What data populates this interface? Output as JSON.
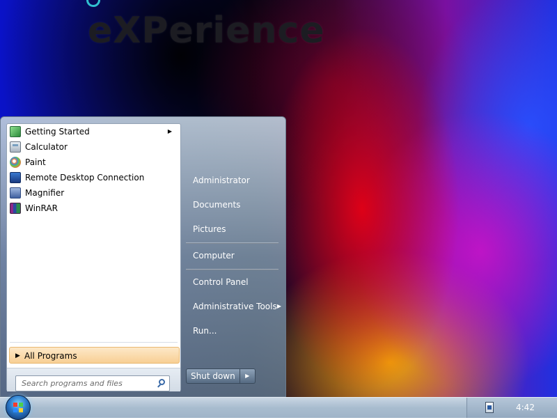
{
  "wallpaper": {
    "logo_text": "eXPerience"
  },
  "start_menu": {
    "programs": [
      {
        "label": "Getting Started",
        "icon": "getting-started-icon",
        "has_submenu": true
      },
      {
        "label": "Calculator",
        "icon": "calculator-icon",
        "has_submenu": false
      },
      {
        "label": "Paint",
        "icon": "paint-icon",
        "has_submenu": false
      },
      {
        "label": "Remote Desktop Connection",
        "icon": "remote-desktop-icon",
        "has_submenu": false
      },
      {
        "label": "Magnifier",
        "icon": "magnifier-icon",
        "has_submenu": false
      },
      {
        "label": "WinRAR",
        "icon": "winrar-icon",
        "has_submenu": false
      }
    ],
    "all_programs_label": "All Programs",
    "search": {
      "placeholder": "Search programs and files"
    },
    "places": [
      {
        "label": "Administrator"
      },
      {
        "label": "Documents"
      },
      {
        "label": "Pictures"
      },
      {
        "label": "Computer"
      },
      {
        "label": "Control Panel"
      },
      {
        "label": "Administrative Tools",
        "has_submenu": true
      },
      {
        "label": "Run..."
      }
    ],
    "shutdown_label": "Shut down"
  },
  "taskbar": {
    "clock": "4:42"
  },
  "colors": {
    "all_programs_highlight": "#f8cf94",
    "menu_text_light": "#ffffff"
  }
}
